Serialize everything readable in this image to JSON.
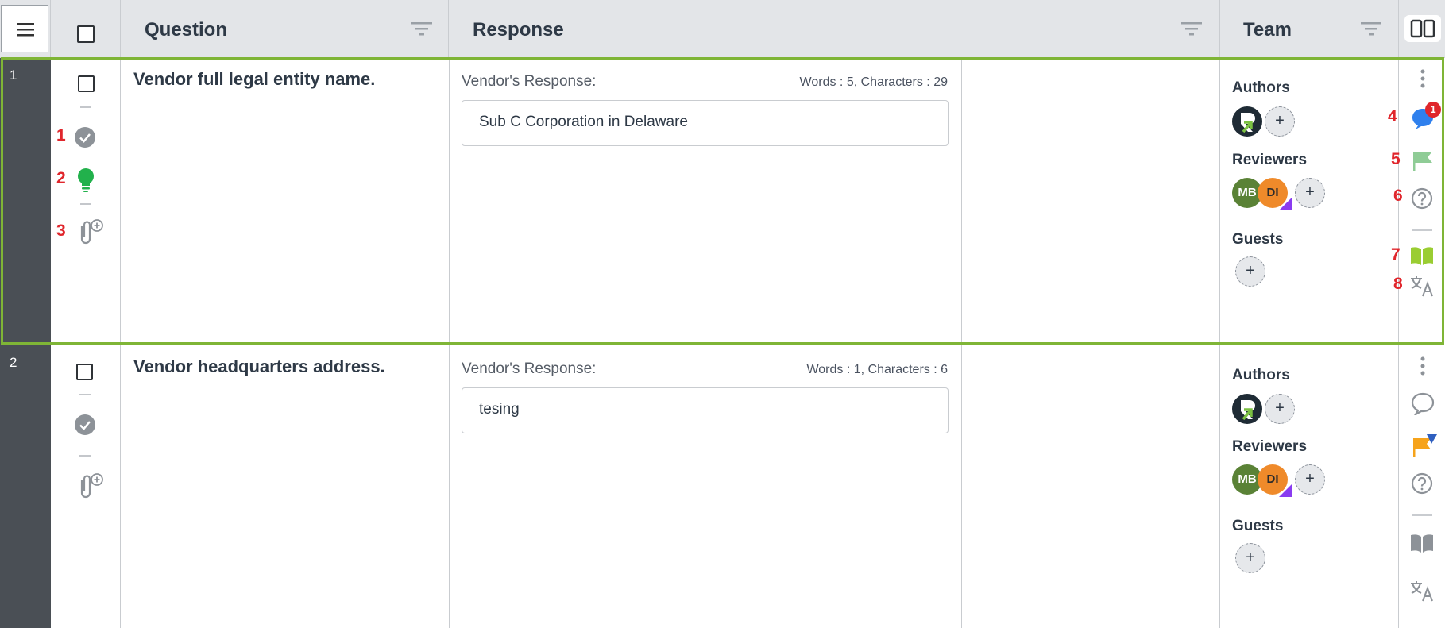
{
  "header": {
    "question_title": "Question",
    "response_title": "Response",
    "team_title": "Team",
    "menu_icon": "hamburger-menu-icon",
    "columns_icon": "columns-toggle-icon"
  },
  "colors": {
    "selected_border": "#7fb536",
    "row_bar": "#4a4f55",
    "annotation_red": "#e0262c",
    "mb_avatar": "#5a8236",
    "di_avatar": "#ef8a2a",
    "comment_blue": "#2f80ed",
    "flag_green": "#8fcc96",
    "flag_orange": "#f6a31b",
    "book_green": "#9acd32"
  },
  "rows": [
    {
      "number": "1",
      "question": "Vendor full legal entity name.",
      "response_label": "Vendor's Response:",
      "counts": "Words : 5, Characters : 29",
      "response_value": "Sub C Corporation in Delaware",
      "team": {
        "authors_label": "Authors",
        "reviewers_label": "Reviewers",
        "guests_label": "Guests",
        "reviewer_initials": [
          "MB",
          "DI"
        ],
        "add_symbol": "+"
      },
      "annotations": {
        "n1": "1",
        "n2": "2",
        "n3": "3",
        "n4": "4",
        "n5": "5",
        "n6": "6",
        "n7": "7",
        "n8": "8"
      },
      "comment_badge": "1"
    },
    {
      "number": "2",
      "question": "Vendor headquarters address.",
      "response_label": "Vendor's Response:",
      "counts": "Words : 1, Characters : 6",
      "response_value": "tesing",
      "team": {
        "authors_label": "Authors",
        "reviewers_label": "Reviewers",
        "guests_label": "Guests",
        "reviewer_initials": [
          "MB",
          "DI"
        ],
        "add_symbol": "+"
      }
    }
  ]
}
